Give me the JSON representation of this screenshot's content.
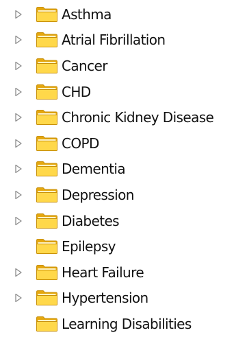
{
  "tree": {
    "items": [
      {
        "label": "Asthma",
        "expandable": true
      },
      {
        "label": "Atrial Fibrillation",
        "expandable": true
      },
      {
        "label": "Cancer",
        "expandable": true
      },
      {
        "label": "CHD",
        "expandable": true
      },
      {
        "label": "Chronic Kidney Disease",
        "expandable": true
      },
      {
        "label": "COPD",
        "expandable": true
      },
      {
        "label": "Dementia",
        "expandable": true
      },
      {
        "label": "Depression",
        "expandable": true
      },
      {
        "label": "Diabetes",
        "expandable": true
      },
      {
        "label": "Epilepsy",
        "expandable": false
      },
      {
        "label": "Heart Failure",
        "expandable": true
      },
      {
        "label": "Hypertension",
        "expandable": true
      },
      {
        "label": "Learning Disabilities",
        "expandable": false
      }
    ],
    "icons": {
      "expander": "triangle-right-outline",
      "folder": "folder-closed-yellow"
    },
    "colors": {
      "folder_fill": "#ffd84a",
      "folder_dark": "#e5a70e",
      "folder_edge": "#c8900a",
      "expander_stroke": "#8c8c8c"
    }
  }
}
